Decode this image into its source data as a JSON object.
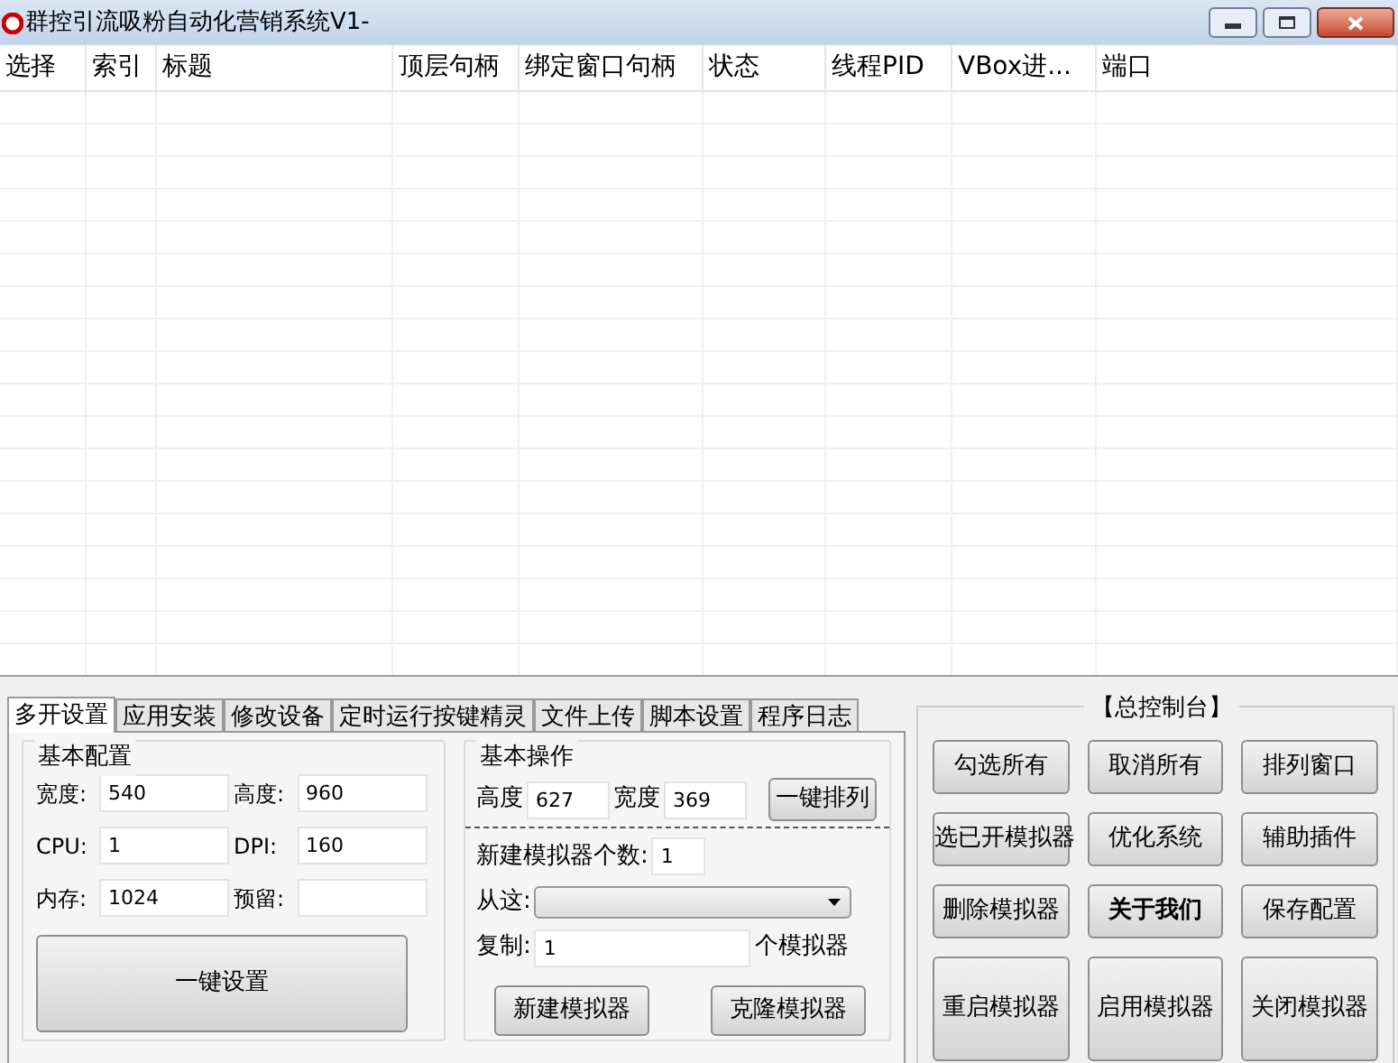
{
  "window": {
    "title": "群控引流吸粉自动化营销系统V1-"
  },
  "table": {
    "columns": [
      "选择",
      "索引",
      "标题",
      "顶层句柄",
      "绑定窗口句柄",
      "状态",
      "线程PID",
      "VBox进...",
      "端口"
    ]
  },
  "tabs": [
    {
      "label": "多开设置",
      "selected": true
    },
    {
      "label": "应用安装",
      "selected": false
    },
    {
      "label": "修改设备",
      "selected": false
    },
    {
      "label": "定时运行按键精灵",
      "selected": false
    },
    {
      "label": "文件上传",
      "selected": false
    },
    {
      "label": "脚本设置",
      "selected": false
    },
    {
      "label": "程序日志",
      "selected": false
    }
  ],
  "basic_config": {
    "title": "基本配置",
    "fields": [
      {
        "label": "宽度:",
        "value": "540"
      },
      {
        "label": "高度:",
        "value": "960"
      },
      {
        "label": "CPU:",
        "value": "1"
      },
      {
        "label": "DPI:",
        "value": "160"
      },
      {
        "label": "内存:",
        "value": "1024"
      },
      {
        "label": "预留:"
      }
    ],
    "button": "一键设置"
  },
  "basic_ops": {
    "title": "基本操作",
    "height_label": "高度",
    "height_value": "627",
    "width_label": "宽度",
    "width_value": "369",
    "arrange_button": "一键排列",
    "count_label": "新建模拟器个数:",
    "count_value": "1",
    "from_label": "从这:",
    "copy_label": "复制:",
    "copy_value": "1",
    "copy_suffix": "个模拟器",
    "buttons": [
      "新建模拟器",
      "克隆模拟器"
    ]
  },
  "console": {
    "title": "【总控制台】",
    "buttons": [
      {
        "label": "勾选所有",
        "bold": false
      },
      {
        "label": "取消所有",
        "bold": false
      },
      {
        "label": "排列窗口",
        "bold": false
      },
      {
        "label": "选已开模拟器",
        "bold": false
      },
      {
        "label": "优化系统",
        "bold": false
      },
      {
        "label": "辅助插件",
        "bold": false
      },
      {
        "label": "删除模拟器",
        "bold": false
      },
      {
        "label": "关于我们",
        "bold": true
      },
      {
        "label": "保存配置",
        "bold": false
      },
      {
        "label": "重启模拟器",
        "bold": false
      },
      {
        "label": "启用模拟器",
        "bold": false
      },
      {
        "label": "关闭模拟器",
        "bold": false
      }
    ]
  }
}
